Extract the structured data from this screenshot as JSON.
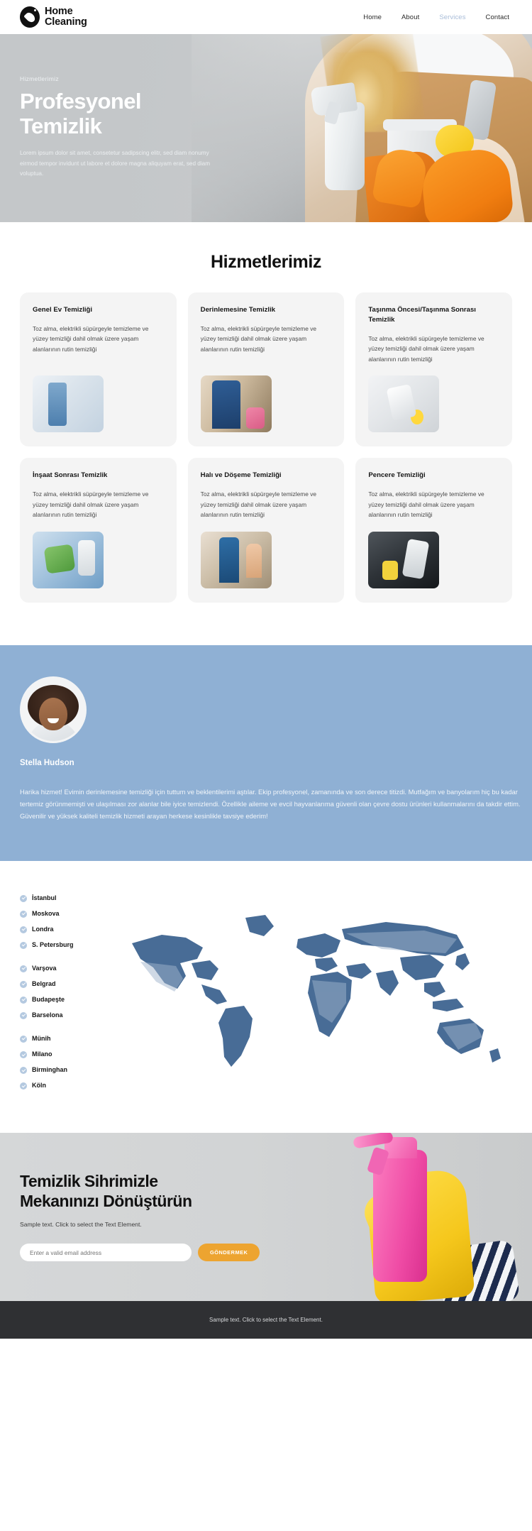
{
  "header": {
    "brand": {
      "line1": "Home",
      "line2": "Cleaning",
      "icon": "water-drop-logo-icon"
    },
    "nav": [
      {
        "label": "Home",
        "active": false
      },
      {
        "label": "About",
        "active": false
      },
      {
        "label": "Services",
        "active": true
      },
      {
        "label": "Contact",
        "active": false
      }
    ]
  },
  "hero": {
    "eyebrow": "Hizmetlerimiz",
    "title_line1": "Profesyonel",
    "title_line2": "Temizlik",
    "description": "Lorem ipsum dolor sit amet, consetetur sadipscing elitr, sed diam nonumy eirmod tempor invidunt ut labore et dolore magna aliquyam erat, sed diam voluptua."
  },
  "services": {
    "title": "Hizmetlerimiz",
    "common_description": "Toz alma, elektrikli süpürgeyle temizleme ve yüzey temizliği dahil olmak üzere yaşam alanlarının rutin temizliği",
    "cards": [
      {
        "title": "Genel Ev Temizliği",
        "image": "spray-bottles-photo"
      },
      {
        "title": "Derinlemesine Temizlik",
        "image": "cleaner-in-blue-uniform-photo"
      },
      {
        "title": "Taşınma Öncesi/Taşınma Sonrası Temizlik",
        "image": "cleaning-tools-flatlay-photo"
      },
      {
        "title": "İnşaat Sonrası Temizlik",
        "image": "gloved-hand-with-sponge-photo"
      },
      {
        "title": "Halı ve Döşeme Temizliği",
        "image": "cleaners-in-living-room-photo"
      },
      {
        "title": "Pencere Temizliği",
        "image": "window-squeegee-photo"
      }
    ]
  },
  "testimonial": {
    "avatar": "smiling-woman-avatar",
    "name": "Stella Hudson",
    "quote": "Harika hizmet! Evimin derinlemesine temizliği için tuttum ve beklentilerimi aştılar. Ekip profesyonel, zamanında ve son derece titizdi. Mutfağım ve banyolarım hiç bu kadar tertemiz görünmemişti ve ulaşılması zor alanlar bile iyice temizlendi. Özellikle aileme ve evcil hayvanlarıma güvenli olan çevre dostu ürünleri kullanmalarını da takdir ettim. Güvenilir ve yüksek kaliteli temizlik hizmeti arayan herkese kesinlikle tavsiye ederim!"
  },
  "locations": {
    "groups": [
      {
        "cities": [
          "İstanbul",
          "Moskova",
          "Londra",
          "S. Petersburg"
        ]
      },
      {
        "cities": [
          "Varşova",
          "Belgrad",
          "Budapeşte",
          "Barselona"
        ]
      },
      {
        "cities": [
          "Münih",
          "Milano",
          "Birminghan",
          "Köln"
        ]
      }
    ],
    "map": "world-map-graphic",
    "check_color": "#b4c9e0"
  },
  "cta": {
    "title_line1": "Temizlik Sihrimizle",
    "title_line2": "Mekanınızı Dönüştürün",
    "subtitle": "Sample text. Click to select the Text Element.",
    "input_value": "",
    "input_placeholder": "Enter a valid email address",
    "button_label": "GÖNDERMEK",
    "button_color": "#eda430",
    "image": "pink-spray-bottle-yellow-glove-photo"
  },
  "footer": {
    "text": "Sample text. Click to select the Text Element.",
    "background": "#2f3033"
  }
}
